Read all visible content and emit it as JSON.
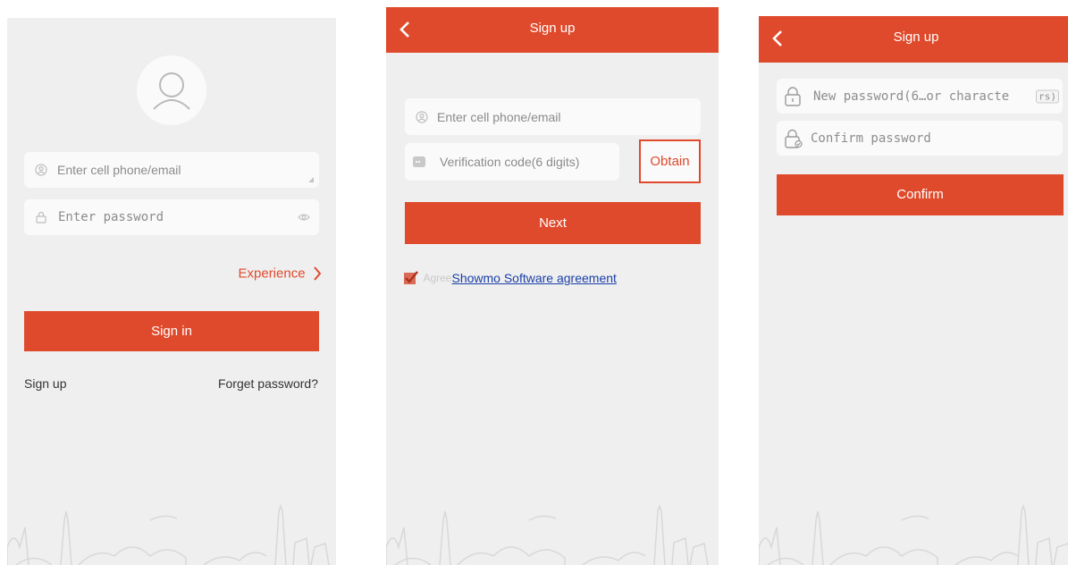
{
  "login": {
    "account_placeholder": "Enter cell phone/email",
    "password_placeholder": "Enter password",
    "experience_label": "Experience",
    "sign_in_label": "Sign in",
    "sign_up_label": "Sign up",
    "forget_password_label": "Forget password?"
  },
  "signup": {
    "title": "Sign up",
    "account_placeholder": "Enter cell phone/email",
    "code_placeholder": "Verification code(6 digits)",
    "obtain_label": "Obtain",
    "next_label": "Next",
    "agree_prefix": "Agree",
    "agreement_link": "Showmo Software agreement"
  },
  "password": {
    "title": "Sign up",
    "new_password_placeholder": "New password(6…or characte",
    "new_password_badge": "rs)",
    "confirm_password_placeholder": "Confirm password",
    "confirm_label": "Confirm"
  },
  "colors": {
    "accent": "#e04a2c",
    "background": "#efefef",
    "field": "#fafafa",
    "link": "#1a3fa8"
  },
  "icons": [
    "avatar-icon",
    "user-icon",
    "lock-icon",
    "eye-icon",
    "chevron-right-icon",
    "back-icon",
    "message-icon",
    "checkbox-icon",
    "skyline-illustration"
  ]
}
